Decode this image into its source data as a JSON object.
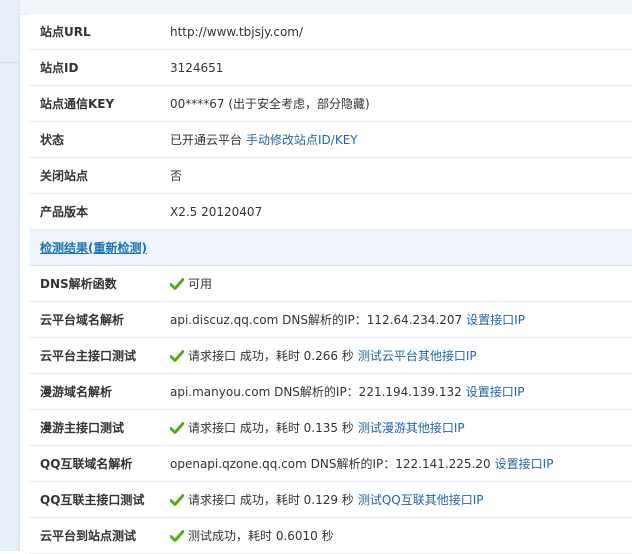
{
  "site_info": [
    {
      "label": "站点URL",
      "value": "http://www.tbjsjy.com/"
    },
    {
      "label": "站点ID",
      "value": "3124651"
    },
    {
      "label": "站点通信KEY",
      "value": "00****67 (出于安全考虑，部分隐藏)"
    },
    {
      "label": "状态",
      "value": "已开通云平台",
      "link": "手动修改站点ID/KEY"
    },
    {
      "label": "关闭站点",
      "value": "否"
    },
    {
      "label": "产品版本",
      "value": "X2.5 20120407"
    }
  ],
  "section": {
    "title": "检测结果(重新检测)"
  },
  "checks": [
    {
      "label": "DNS解析函数",
      "ok": true,
      "value": "可用",
      "link": ""
    },
    {
      "label": "云平台域名解析",
      "ok": false,
      "value": "api.discuz.qq.com DNS解析的IP：112.64.234.207",
      "link": "设置接口IP"
    },
    {
      "label": "云平台主接口测试",
      "ok": true,
      "value": "请求接口 成功，耗时 0.266 秒",
      "link": "测试云平台其他接口IP"
    },
    {
      "label": "漫游域名解析",
      "ok": false,
      "value": "api.manyou.com DNS解析的IP：221.194.139.132",
      "link": "设置接口IP"
    },
    {
      "label": "漫游主接口测试",
      "ok": true,
      "value": "请求接口 成功，耗时 0.135 秒",
      "link": "测试漫游其他接口IP"
    },
    {
      "label": "QQ互联域名解析",
      "ok": false,
      "value": "openapi.qzone.qq.com DNS解析的IP：122.141.225.20",
      "link": "设置接口IP"
    },
    {
      "label": "QQ互联主接口测试",
      "ok": true,
      "value": "请求接口 成功，耗时 0.129 秒",
      "link": "测试QQ互联其他接口IP"
    },
    {
      "label": "云平台到站点测试",
      "ok": true,
      "value": "测试成功，耗时 0.6010 秒",
      "link": ""
    }
  ],
  "colors": {
    "link": "#2366a8",
    "section_title": "#1e74b8",
    "check_green": "#4caf1e"
  }
}
